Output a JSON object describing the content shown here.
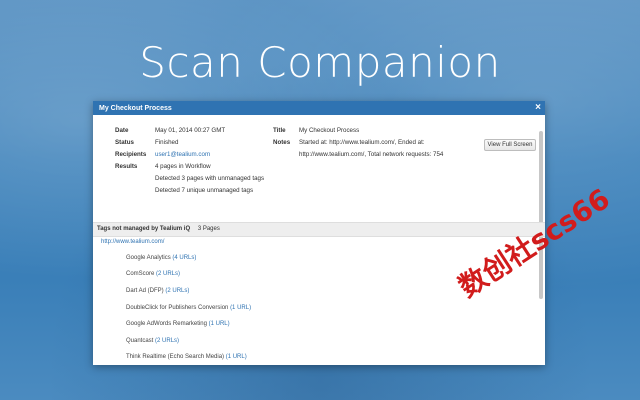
{
  "hero": {
    "title": "Scan Companion"
  },
  "modal": {
    "title": "My Checkout Process",
    "close_glyph": "×",
    "summary": {
      "date_label": "Date",
      "date_value": "May 01, 2014 00:27 GMT",
      "status_label": "Status",
      "status_value": "Finished",
      "recipients_label": "Recipients",
      "recipients_value": "user1@tealium.com",
      "results_label": "Results",
      "results_lines": [
        "4 pages in Workflow",
        "Detected 3 pages with unmanaged tags",
        "Detected 7 unique unmanaged tags"
      ],
      "title_label": "Title",
      "title_value": "My Checkout Process",
      "notes_label": "Notes",
      "notes_line1": "Started at: http://www.tealium.com/, Ended at:",
      "notes_line2": "http://www.tealium.com/, Total network requests: 754",
      "view_full_screen": "View Full Screen"
    },
    "section": {
      "title": "Tags not managed by Tealium iQ",
      "count": "3 Pages"
    },
    "site_url": "http://www.tealium.com/",
    "tags": [
      {
        "name": "Google Analytics",
        "count": "(4 URLs)"
      },
      {
        "name": "ComScore",
        "count": "(2 URLs)"
      },
      {
        "name": "Dart Ad (DFP)",
        "count": "(2 URLs)"
      },
      {
        "name": "DoubleClick for Publishers Conversion",
        "count": "(1 URL)"
      },
      {
        "name": "Google AdWords Remarketing",
        "count": "(1 URL)"
      },
      {
        "name": "Quantcast",
        "count": "(2 URLs)"
      },
      {
        "name": "Think Realtime (Echo Search Media)",
        "count": "(1 URL)"
      }
    ]
  },
  "watermark": {
    "text": "数创社scs66"
  },
  "colors": {
    "accent": "#2f73b2",
    "watermark": "#d11c1c"
  }
}
